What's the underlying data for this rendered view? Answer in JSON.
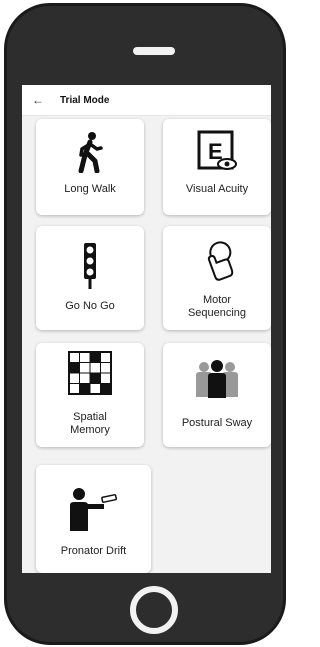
{
  "appbar": {
    "back_icon": "arrow-left-icon",
    "title": "Trial Mode"
  },
  "tiles": [
    {
      "label": "Long Walk",
      "icon": "walking-person-icon"
    },
    {
      "label": "Visual Acuity",
      "icon": "eye-chart-icon"
    },
    {
      "label": "Go No Go",
      "icon": "traffic-light-icon"
    },
    {
      "label": "Motor\nSequencing",
      "icon": "finger-tap-icon"
    },
    {
      "label": "Spatial\nMemory",
      "icon": "grid-memory-icon"
    },
    {
      "label": "Postural Sway",
      "icon": "people-group-icon"
    },
    {
      "label": "Pronator Drift",
      "icon": "person-arm-extended-icon"
    }
  ],
  "colors": {
    "phone_body": "#2d2d2d",
    "screen_bg": "#f2f2f2",
    "card_bg": "#ffffff"
  }
}
